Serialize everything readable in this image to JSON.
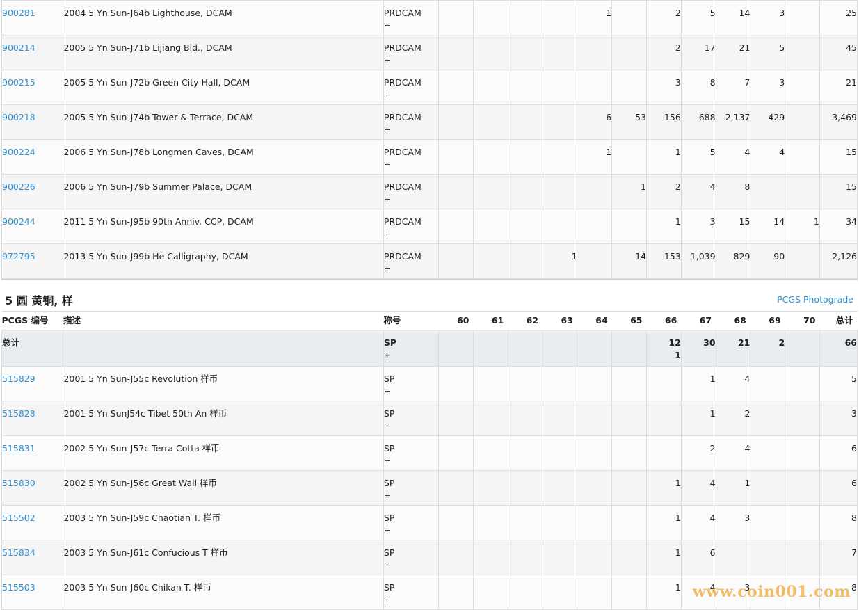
{
  "top_rows": [
    {
      "id": "900281",
      "desc": "2004 5 Yn Sun-J64b Lighthouse, DCAM",
      "des": "PRDCAM",
      "plus": "+",
      "g": [
        "",
        "",
        "",
        "",
        "1",
        "",
        "2",
        "5",
        "14",
        "3",
        ""
      ],
      "total": "25"
    },
    {
      "id": "900214",
      "desc": "2005 5 Yn Sun-J71b Lijiang Bld., DCAM",
      "des": "PRDCAM",
      "plus": "+",
      "g": [
        "",
        "",
        "",
        "",
        "",
        "",
        "2",
        "17",
        "21",
        "5",
        ""
      ],
      "total": "45"
    },
    {
      "id": "900215",
      "desc": "2005 5 Yn Sun-J72b Green City Hall, DCAM",
      "des": "PRDCAM",
      "plus": "+",
      "g": [
        "",
        "",
        "",
        "",
        "",
        "",
        "3",
        "8",
        "7",
        "3",
        ""
      ],
      "total": "21"
    },
    {
      "id": "900218",
      "desc": "2005 5 Yn Sun-J74b Tower & Terrace, DCAM",
      "des": "PRDCAM",
      "plus": "+",
      "g": [
        "",
        "",
        "",
        "",
        "6",
        "53",
        "156",
        "688",
        "2,137",
        "429",
        ""
      ],
      "total": "3,469"
    },
    {
      "id": "900224",
      "desc": "2006 5 Yn Sun-J78b Longmen Caves, DCAM",
      "des": "PRDCAM",
      "plus": "+",
      "g": [
        "",
        "",
        "",
        "",
        "1",
        "",
        "1",
        "5",
        "4",
        "4",
        ""
      ],
      "total": "15"
    },
    {
      "id": "900226",
      "desc": "2006 5 Yn Sun-J79b Summer Palace, DCAM",
      "des": "PRDCAM",
      "plus": "+",
      "g": [
        "",
        "",
        "",
        "",
        "",
        "1",
        "2",
        "4",
        "8",
        "",
        ""
      ],
      "total": "15"
    },
    {
      "id": "900244",
      "desc": "2011 5 Yn Sun-J95b 90th Anniv. CCP, DCAM",
      "des": "PRDCAM",
      "plus": "+",
      "g": [
        "",
        "",
        "",
        "",
        "",
        "",
        "1",
        "3",
        "15",
        "14",
        "1"
      ],
      "total": "34"
    },
    {
      "id": "972795",
      "desc": "2013 5 Yn Sun-J99b He Calligraphy, DCAM",
      "des": "PRDCAM",
      "plus": "+",
      "g": [
        "",
        "",
        "",
        "1",
        "",
        "14",
        "153",
        "1,039",
        "829",
        "90",
        ""
      ],
      "total": "2,126"
    }
  ],
  "section": {
    "title": "5 圆 黄铜, 样",
    "link": "PCGS Photograde"
  },
  "header": {
    "id": "PCGS 编号",
    "desc": "描述",
    "des": "称号",
    "grades": [
      "60",
      "61",
      "62",
      "63",
      "64",
      "65",
      "66",
      "67",
      "68",
      "69",
      "70"
    ],
    "total": "总计"
  },
  "totals": {
    "label": "总计",
    "des": "SP",
    "plus": "+",
    "g": [
      "",
      "",
      "",
      "",
      "",
      "",
      "12",
      "30",
      "21",
      "2",
      ""
    ],
    "g66_line2": "1",
    "total": "66"
  },
  "bottom_rows": [
    {
      "id": "515829",
      "desc": "2001 5 Yn Sun-J55c Revolution 样币",
      "des": "SP",
      "plus": "+",
      "g": [
        "",
        "",
        "",
        "",
        "",
        "",
        "",
        "1",
        "4",
        "",
        ""
      ],
      "total": "5"
    },
    {
      "id": "515828",
      "desc": "2001 5 Yn SunJ54c Tibet 50th An 样币",
      "des": "SP",
      "plus": "+",
      "g": [
        "",
        "",
        "",
        "",
        "",
        "",
        "",
        "1",
        "2",
        "",
        ""
      ],
      "total": "3"
    },
    {
      "id": "515831",
      "desc": "2002 5 Yn Sun-J57c Terra Cotta 样币",
      "des": "SP",
      "plus": "+",
      "g": [
        "",
        "",
        "",
        "",
        "",
        "",
        "",
        "2",
        "4",
        "",
        ""
      ],
      "total": "6"
    },
    {
      "id": "515830",
      "desc": "2002 5 Yn Sun-J56c Great Wall 样币",
      "des": "SP",
      "plus": "+",
      "g": [
        "",
        "",
        "",
        "",
        "",
        "",
        "1",
        "4",
        "1",
        "",
        ""
      ],
      "total": "6"
    },
    {
      "id": "515502",
      "desc": "2003 5 Yn Sun-J59c Chaotian T. 样币",
      "des": "SP",
      "plus": "+",
      "g": [
        "",
        "",
        "",
        "",
        "",
        "",
        "1",
        "4",
        "3",
        "",
        ""
      ],
      "total": "8"
    },
    {
      "id": "515834",
      "desc": "2003 5 Yn Sun-J61c Confucious T 样币",
      "des": "SP",
      "plus": "+",
      "g": [
        "",
        "",
        "",
        "",
        "",
        "",
        "1",
        "6",
        "",
        "",
        ""
      ],
      "total": "7"
    },
    {
      "id": "515503",
      "desc": "2003 5 Yn Sun-J60c Chikan T. 样币",
      "des": "SP",
      "plus": "+",
      "g": [
        "",
        "",
        "",
        "",
        "",
        "",
        "1",
        "4",
        "3",
        "",
        ""
      ],
      "total": "8"
    }
  ],
  "watermark": "www.coin001.com"
}
